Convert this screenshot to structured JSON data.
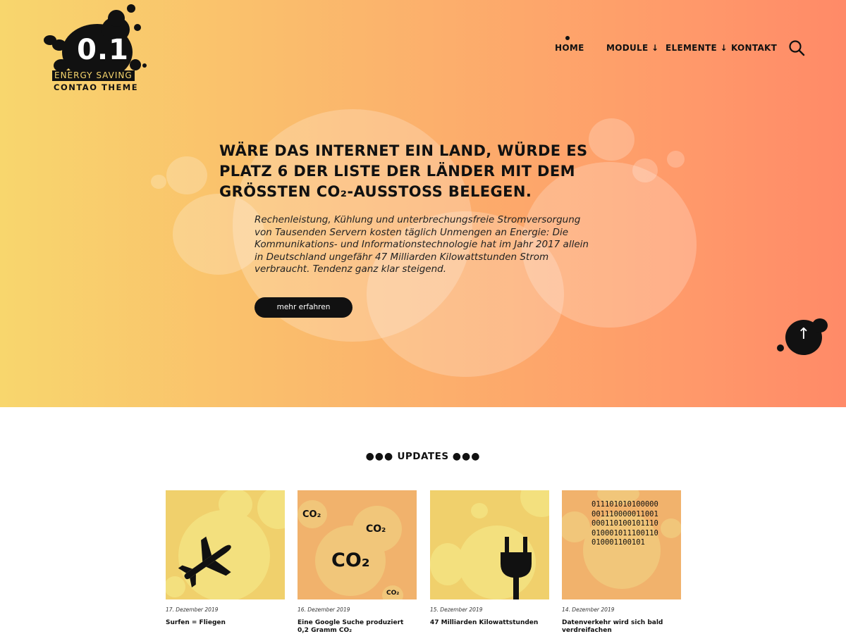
{
  "logo": {
    "number": "0.1",
    "line1": "ENERGY SAVING",
    "line2": "CONTAO THEME"
  },
  "nav": {
    "items": [
      {
        "label": "HOME"
      },
      {
        "label": "MODULE ↓"
      },
      {
        "label": "ELEMENTE ↓"
      },
      {
        "label": "KONTAKT"
      }
    ],
    "search_icon": "search-icon"
  },
  "hero": {
    "headline": "WÄRE DAS INTERNET EIN LAND, WÜRDE ES PLATZ 6 DER LISTE DER LÄNDER MIT DEM GRÖSSTEN CO₂-AUSSTOSS BELEGEN.",
    "lead": "Rechenleistung, Kühlung und unterbrechungsfreie Stromversorgung von Tausenden Servern kosten täglich Unmengen an Energie: Die Kommunikations- und Informationstechnologie hat im Jahr 2017 allein in Deutschland ungefähr 47 Milliarden Kilowattstunden Strom verbraucht. Tendenz ganz klar steigend.",
    "button": "mehr erfahren",
    "to_top_icon": "arrow-up-icon"
  },
  "updates": {
    "title": "UPDATES",
    "dots": "●●●",
    "cards": [
      {
        "date": "17. Dezember 2019",
        "title": "Surfen = Fliegen",
        "icon": "airplane-icon"
      },
      {
        "date": "16. Dezember 2019",
        "title": "Eine Google Suche produziert 0,2 Gramm CO₂",
        "icon": "co2-icon",
        "labels": [
          "CO₂",
          "CO₂",
          "CO₂",
          "CO₂"
        ]
      },
      {
        "date": "15. Dezember 2019",
        "title": "47 Milliarden Kilowattstunden",
        "icon": "plug-icon"
      },
      {
        "date": "14. Dezember 2019",
        "title": "Datenverkehr wird sich bald verdreifachen",
        "icon": "binary-icon",
        "binary": "011101010100000\n001110000011001\n000110100101110\n010001011100110\n010001100101"
      }
    ]
  },
  "colors": {
    "gradient_start": "#f8d66d",
    "gradient_end": "#ff8a68",
    "yellow": "#f3dd73",
    "orange": "#f4b46a",
    "black": "#111111"
  }
}
